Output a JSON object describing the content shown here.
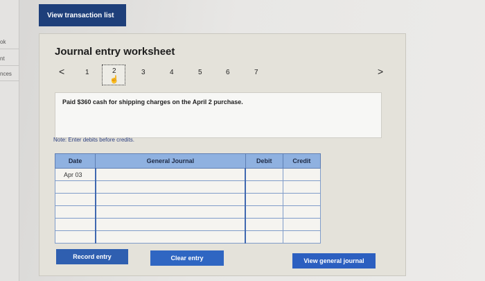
{
  "topbar": {
    "view_transaction_list": "View transaction list"
  },
  "left_edge": {
    "items": [
      "ok",
      "nt",
      "nces"
    ]
  },
  "worksheet": {
    "title": "Journal entry worksheet",
    "pager": {
      "prev": "<",
      "next": ">",
      "pages": [
        "1",
        "2",
        "3",
        "4",
        "5",
        "6",
        "7"
      ],
      "active": "2"
    },
    "description": "Paid $360 cash for shipping charges on the April 2 purchase.",
    "note": "Note: Enter debits before credits.",
    "table": {
      "headers": {
        "date": "Date",
        "general_journal": "General Journal",
        "debit": "Debit",
        "credit": "Credit"
      },
      "rows": [
        {
          "date": "Apr 03",
          "account": "",
          "debit": "",
          "credit": ""
        },
        {
          "date": "",
          "account": "",
          "debit": "",
          "credit": ""
        },
        {
          "date": "",
          "account": "",
          "debit": "",
          "credit": ""
        },
        {
          "date": "",
          "account": "",
          "debit": "",
          "credit": ""
        },
        {
          "date": "",
          "account": "",
          "debit": "",
          "credit": ""
        },
        {
          "date": "",
          "account": "",
          "debit": "",
          "credit": ""
        }
      ]
    },
    "buttons": {
      "record": "Record entry",
      "clear": "Clear entry",
      "view_general_journal": "View general journal"
    }
  },
  "colors": {
    "header_blue": "#8fb1e0",
    "button_blue": "#2f5fb0",
    "dark_button": "#1e3f7a"
  }
}
